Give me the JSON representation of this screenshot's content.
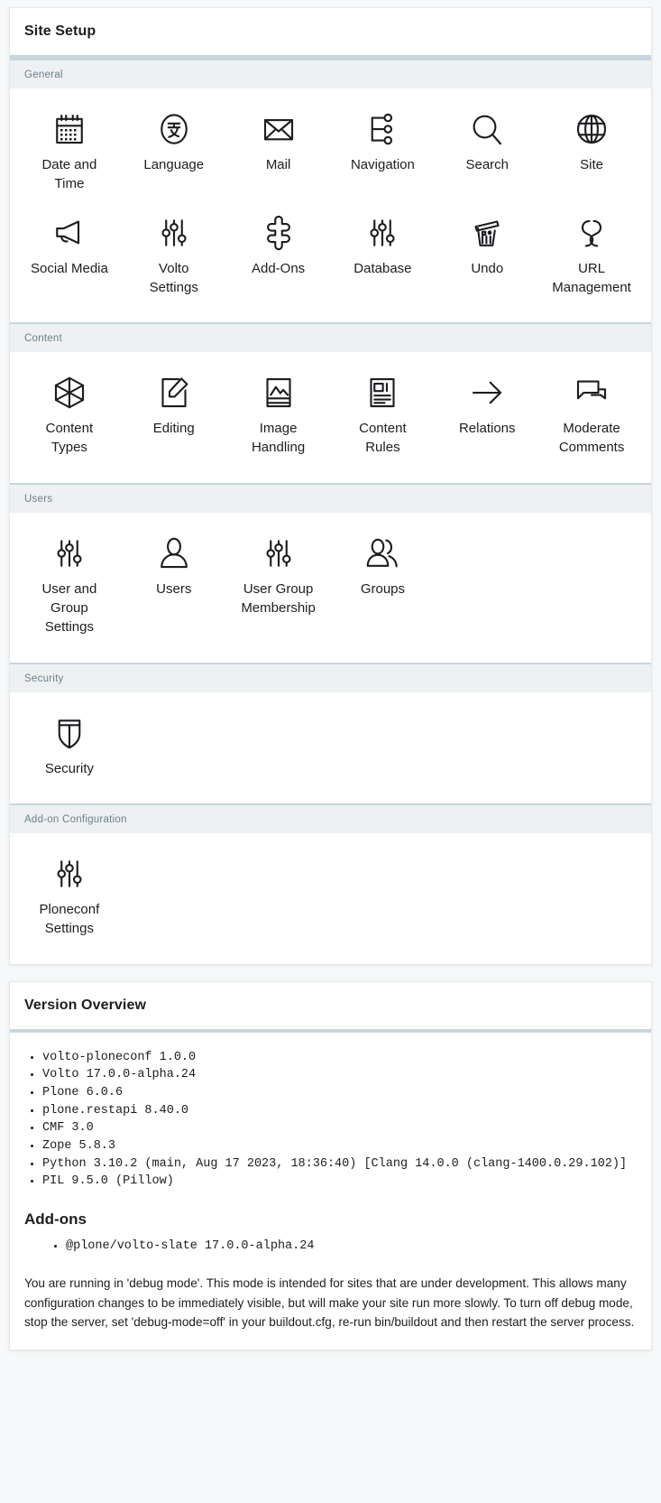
{
  "site_setup": {
    "title": "Site Setup",
    "sections": [
      {
        "id": "general",
        "label": "General",
        "tiles": [
          {
            "label": "Date and Time",
            "icon": "calendar-icon"
          },
          {
            "label": "Language",
            "icon": "language-icon"
          },
          {
            "label": "Mail",
            "icon": "envelope-icon"
          },
          {
            "label": "Navigation",
            "icon": "navigation-icon"
          },
          {
            "label": "Search",
            "icon": "magnifier-icon"
          },
          {
            "label": "Site",
            "icon": "globe-icon"
          },
          {
            "label": "Social Media",
            "icon": "megaphone-icon"
          },
          {
            "label": "Volto Settings",
            "icon": "sliders-icon"
          },
          {
            "label": "Add-Ons",
            "icon": "puzzle-icon"
          },
          {
            "label": "Database",
            "icon": "sliders-icon"
          },
          {
            "label": "Undo",
            "icon": "trash-icon"
          },
          {
            "label": "URL Management",
            "icon": "link-icon"
          }
        ]
      },
      {
        "id": "content",
        "label": "Content",
        "tiles": [
          {
            "label": "Content Types",
            "icon": "cube-icon"
          },
          {
            "label": "Editing",
            "icon": "pencil-page-icon"
          },
          {
            "label": "Image Handling",
            "icon": "image-icon"
          },
          {
            "label": "Content Rules",
            "icon": "document-list-icon"
          },
          {
            "label": "Relations",
            "icon": "arrow-right-icon"
          },
          {
            "label": "Moderate Comments",
            "icon": "comments-icon"
          }
        ]
      },
      {
        "id": "users",
        "label": "Users",
        "tiles": [
          {
            "label": "User and Group Settings",
            "icon": "sliders-icon"
          },
          {
            "label": "Users",
            "icon": "user-icon"
          },
          {
            "label": "User Group Membership",
            "icon": "sliders-icon"
          },
          {
            "label": "Groups",
            "icon": "users-group-icon"
          }
        ]
      },
      {
        "id": "security",
        "label": "Security",
        "tiles": [
          {
            "label": "Security",
            "icon": "shield-icon"
          }
        ]
      },
      {
        "id": "addon-configuration",
        "label": "Add-on Configuration",
        "tiles": [
          {
            "label": "Ploneconf Settings",
            "icon": "sliders-icon"
          }
        ]
      }
    ]
  },
  "version_overview": {
    "title": "Version Overview",
    "versions": [
      "volto-ploneconf 1.0.0",
      "Volto 17.0.0-alpha.24",
      "Plone 6.0.6",
      "plone.restapi 8.40.0",
      "CMF 3.0",
      "Zope 5.8.3",
      "Python 3.10.2 (main, Aug 17 2023, 18:36:40) [Clang 14.0.0 (clang-1400.0.29.102)]",
      "PIL 9.5.0 (Pillow)"
    ],
    "addons_title": "Add-ons",
    "addons": [
      "@plone/volto-slate 17.0.0-alpha.24"
    ],
    "debug_note": "You are running in 'debug mode'. This mode is intended for sites that are under development. This allows many configuration changes to be immediately visible, but will make your site run more slowly. To turn off debug mode, stop the server, set 'debug-mode=off' in your buildout.cfg, re-run bin/buildout and then restart the server process."
  },
  "colors": {
    "band_bg": "#edf1f2",
    "band_border": "#c7d5dd",
    "band_text": "#6d8089",
    "card_border": "#e4e8eb",
    "text": "#1c1d20",
    "page_bg": "#f7f8f9"
  }
}
